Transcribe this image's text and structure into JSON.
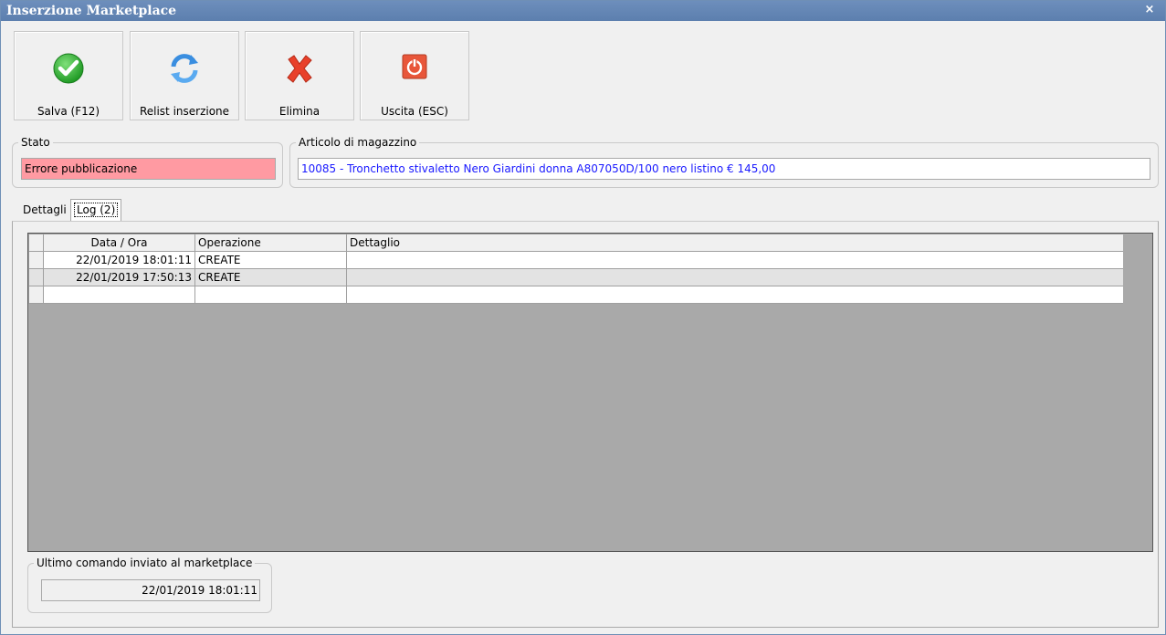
{
  "window": {
    "title": "Inserzione Marketplace",
    "close_glyph": "×"
  },
  "toolbar": {
    "buttons": [
      {
        "label": "Salva (F12)",
        "icon": "check-circle-icon"
      },
      {
        "label": "Relist inserzione",
        "icon": "refresh-icon"
      },
      {
        "label": "Elimina",
        "icon": "red-x-icon"
      },
      {
        "label": "Uscita (ESC)",
        "icon": "power-icon"
      }
    ]
  },
  "stato": {
    "legend": "Stato",
    "value": "Errore pubblicazione",
    "bg_color": "#ff9aa2"
  },
  "articolo": {
    "legend": "Articolo di magazzino",
    "value": "10085 - Tronchetto stivaletto Nero Giardini donna A807050D/100 nero listino € 145,00",
    "text_color": "#1a1aff"
  },
  "tabs": [
    {
      "label": "Dettagli",
      "active": false
    },
    {
      "label": "Log (2)",
      "active": true
    }
  ],
  "log_table": {
    "columns": [
      "Data / Ora",
      "Operazione",
      "Dettaglio"
    ],
    "rows": [
      {
        "date": "22/01/2019 18:01:11",
        "op": "CREATE",
        "detail": ""
      },
      {
        "date": "22/01/2019 17:50:13",
        "op": "CREATE",
        "detail": ""
      },
      {
        "date": "",
        "op": "",
        "detail": ""
      }
    ]
  },
  "ultimo": {
    "legend": "Ultimo comando inviato al marketplace",
    "value": "22/01/2019 18:01:11"
  }
}
